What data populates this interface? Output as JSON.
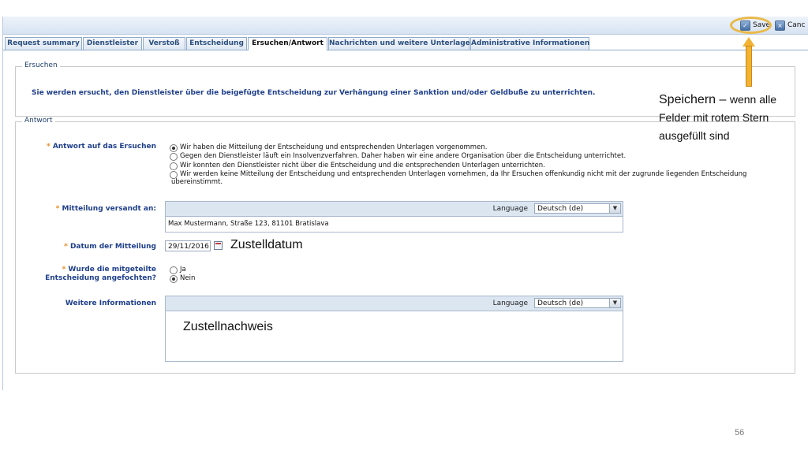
{
  "toolbar": {
    "save_label": "Save",
    "cancel_label": "Canc"
  },
  "tabs": [
    {
      "label": "Request summary"
    },
    {
      "label": "Dienstleister"
    },
    {
      "label": "Verstoß"
    },
    {
      "label": "Entscheidung"
    },
    {
      "label": "Ersuchen/Antwort",
      "active": true
    },
    {
      "label": "Nachrichten und weitere Unterlagen"
    },
    {
      "label": "Administrative Informationen"
    }
  ],
  "ersuchen": {
    "legend": "Ersuchen",
    "text": "Sie werden ersucht, den Dienstleister über die beigefügte Entscheidung zur Verhängung einer Sanktion und/oder Geldbuße zu unterrichten."
  },
  "antwort": {
    "legend": "Antwort",
    "answer_label": "Antwort auf das Ersuchen",
    "answer_options": [
      {
        "text": "Wir haben die Mitteilung der Entscheidung und entsprechenden Unterlagen vorgenommen.",
        "selected": true
      },
      {
        "text": "Gegen den Dienstleister läuft ein Insolvenzverfahren. Daher haben wir eine andere Organisation über die Entscheidung unterrichtet.",
        "selected": false
      },
      {
        "text": "Wir konnten den Dienstleister nicht über die Entscheidung und die entsprechenden Unterlagen unterrichten.",
        "selected": false
      },
      {
        "text": "Wir werden keine Mitteilung der Entscheidung und entsprechenden Unterlagen vornehmen, da Ihr Ersuchen offenkundig nicht mit der zugrunde liegenden Entscheidung",
        "text2": "übereinstimmt.",
        "selected": false
      }
    ],
    "sent_label": "Mitteilung versandt an:",
    "sent_language_label": "Language",
    "sent_language_value": "Deutsch (de)",
    "sent_value": "Max Mustermann, Straße 123, 81101 Bratislava",
    "date_label": "Datum der Mitteilung",
    "date_value": "29/11/2016",
    "contested_label_1": "Wurde die mitgeteilte",
    "contested_label_2": "Entscheidung angefochten?",
    "contested_options": [
      {
        "text": "Ja",
        "selected": false
      },
      {
        "text": "Nein",
        "selected": true
      }
    ],
    "more_label": "Weitere Informationen",
    "more_language_label": "Language",
    "more_language_value": "Deutsch (de)",
    "more_value": ""
  },
  "annotations": {
    "save_hint_prefix": "Speichern – ",
    "save_hint_rest_1": "wenn alle",
    "save_hint_line2": "Felder mit rotem Stern",
    "save_hint_line3": "ausgefüllt sind",
    "date_hint": "Zustelldatum",
    "proof_hint": "Zustellnachweis"
  },
  "page_number": "56",
  "colors": {
    "accent": "#1f3f8b",
    "required_star": "#e8891c",
    "highlight": "#e9b949"
  }
}
